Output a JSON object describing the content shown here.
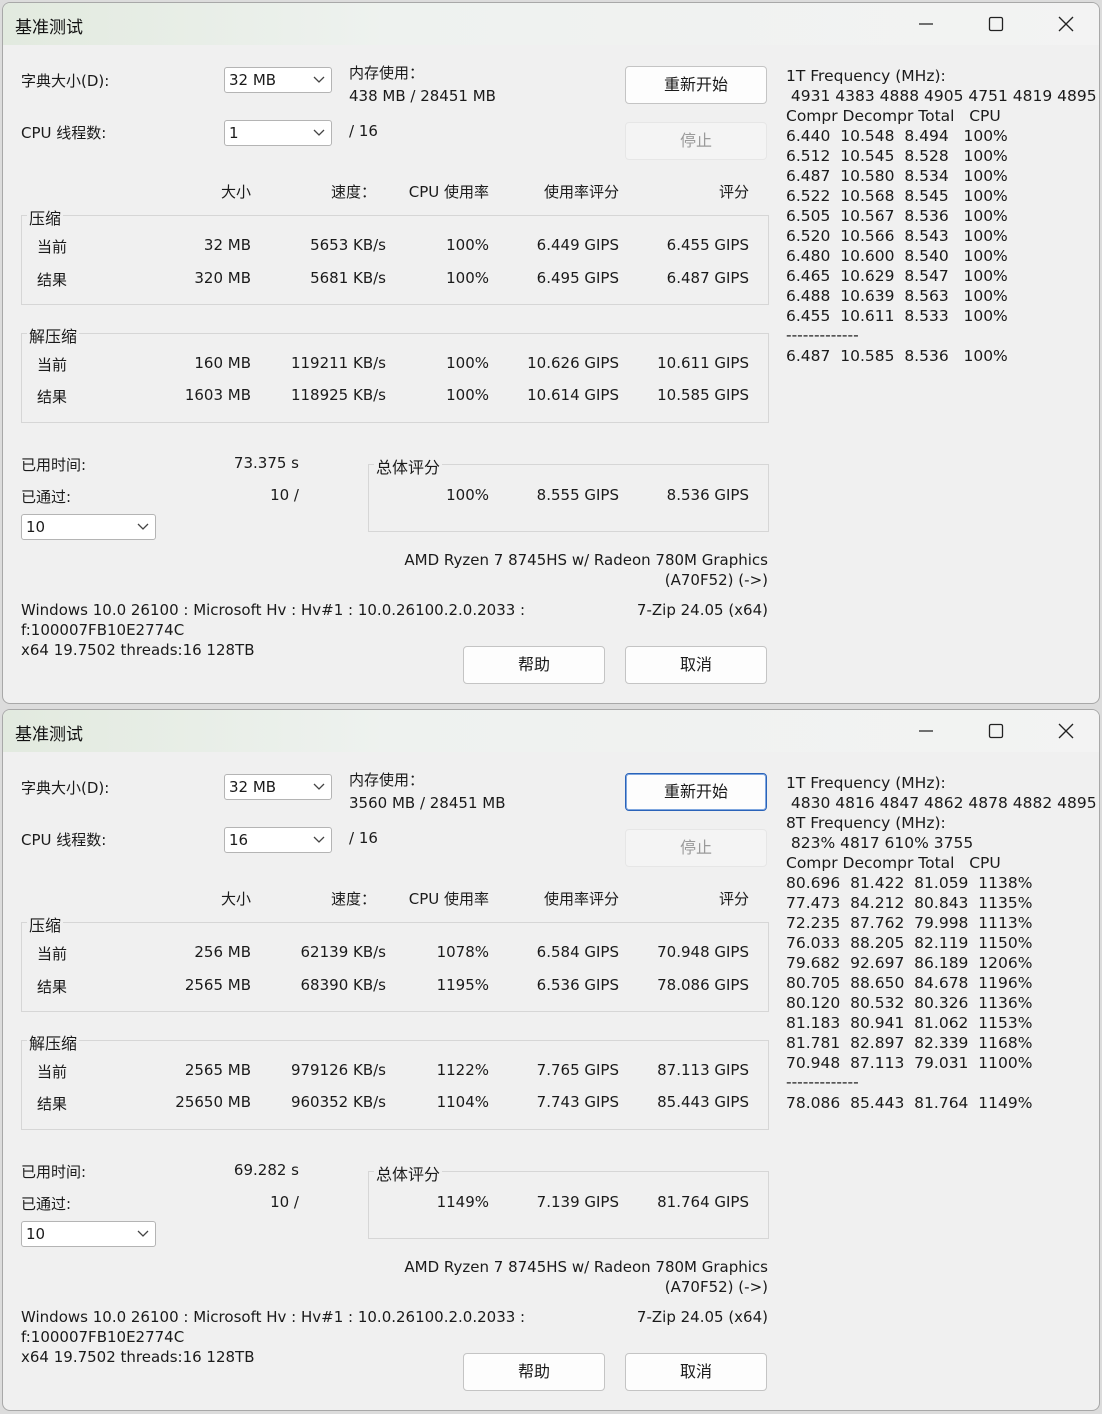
{
  "windows": [
    {
      "title": "基准测试",
      "dict_size_label": "字典大小(D):",
      "dict_size_value": "32 MB",
      "threads_label": "CPU 线程数:",
      "threads_value": "1",
      "threads_total": "/ 16",
      "memory_label": "内存使用：",
      "memory_value": "438 MB / 28451 MB",
      "restart_button": "重新开始",
      "stop_button": "停止",
      "headers": {
        "size": "大小",
        "speed": "速度：",
        "cpu": "CPU 使用率",
        "usage_rating": "使用率评分",
        "rating": "评分"
      },
      "compress": {
        "label": "压缩",
        "current": {
          "label": "当前",
          "size": "32 MB",
          "speed": "5653 KB/s",
          "cpu": "100%",
          "usage": "6.449 GIPS",
          "rating": "6.455 GIPS"
        },
        "result": {
          "label": "结果",
          "size": "320 MB",
          "speed": "5681 KB/s",
          "cpu": "100%",
          "usage": "6.495 GIPS",
          "rating": "6.487 GIPS"
        }
      },
      "decompress": {
        "label": "解压缩",
        "current": {
          "label": "当前",
          "size": "160 MB",
          "speed": "119211 KB/s",
          "cpu": "100%",
          "usage": "10.626 GIPS",
          "rating": "10.611 GIPS"
        },
        "result": {
          "label": "结果",
          "size": "1603 MB",
          "speed": "118925 KB/s",
          "cpu": "100%",
          "usage": "10.614 GIPS",
          "rating": "10.585 GIPS"
        }
      },
      "elapsed_label": "已用时间:",
      "elapsed_value": "73.375 s",
      "passed_label": "已通过:",
      "passed_value": "10 /",
      "passes_select": "10",
      "total_label": "总体评分",
      "total": {
        "cpu": "100%",
        "usage": "8.555 GIPS",
        "rating": "8.536 GIPS"
      },
      "cpu_name": "AMD Ryzen 7 8745HS w/ Radeon 780M Graphics",
      "cpu_id": "(A70F52) (->)",
      "sys_line1": "Windows 10.0 26100 : Microsoft Hv : Hv#1 : 10.0.26100.2.0.2033 :",
      "sys_line2": "f:100007FB10E2774C",
      "sys_line3": "x64 19.7502 threads:16 128TB",
      "version": "7-Zip 24.05 (x64)",
      "help_button": "帮助",
      "cancel_button": "取消",
      "right_lines": [
        "1T Frequency (MHz):",
        " 4931 4383 4888 4905 4751 4819 4895",
        "Compr Decompr Total   CPU",
        "6.440  10.548  8.494   100%",
        "6.512  10.545  8.528   100%",
        "6.487  10.580  8.534   100%",
        "6.522  10.568  8.545   100%",
        "6.505  10.567  8.536   100%",
        "6.520  10.566  8.543   100%",
        "6.480  10.600  8.540   100%",
        "6.465  10.629  8.547   100%",
        "6.488  10.639  8.563   100%",
        "6.455  10.611  8.533   100%",
        "-------------",
        "6.487  10.585  8.536   100%"
      ]
    },
    {
      "title": "基准测试",
      "dict_size_label": "字典大小(D):",
      "dict_size_value": "32 MB",
      "threads_label": "CPU 线程数:",
      "threads_value": "16",
      "threads_total": "/ 16",
      "memory_label": "内存使用：",
      "memory_value": "3560 MB / 28451 MB",
      "restart_button": "重新开始",
      "stop_button": "停止",
      "headers": {
        "size": "大小",
        "speed": "速度：",
        "cpu": "CPU 使用率",
        "usage_rating": "使用率评分",
        "rating": "评分"
      },
      "compress": {
        "label": "压缩",
        "current": {
          "label": "当前",
          "size": "256 MB",
          "speed": "62139 KB/s",
          "cpu": "1078%",
          "usage": "6.584 GIPS",
          "rating": "70.948 GIPS"
        },
        "result": {
          "label": "结果",
          "size": "2565 MB",
          "speed": "68390 KB/s",
          "cpu": "1195%",
          "usage": "6.536 GIPS",
          "rating": "78.086 GIPS"
        }
      },
      "decompress": {
        "label": "解压缩",
        "current": {
          "label": "当前",
          "size": "2565 MB",
          "speed": "979126 KB/s",
          "cpu": "1122%",
          "usage": "7.765 GIPS",
          "rating": "87.113 GIPS"
        },
        "result": {
          "label": "结果",
          "size": "25650 MB",
          "speed": "960352 KB/s",
          "cpu": "1104%",
          "usage": "7.743 GIPS",
          "rating": "85.443 GIPS"
        }
      },
      "elapsed_label": "已用时间:",
      "elapsed_value": "69.282 s",
      "passed_label": "已通过:",
      "passed_value": "10 /",
      "passes_select": "10",
      "total_label": "总体评分",
      "total": {
        "cpu": "1149%",
        "usage": "7.139 GIPS",
        "rating": "81.764 GIPS"
      },
      "cpu_name": "AMD Ryzen 7 8745HS w/ Radeon 780M Graphics",
      "cpu_id": "(A70F52) (->)",
      "sys_line1": "Windows 10.0 26100 : Microsoft Hv : Hv#1 : 10.0.26100.2.0.2033 :",
      "sys_line2": "f:100007FB10E2774C",
      "sys_line3": "x64 19.7502 threads:16 128TB",
      "version": "7-Zip 24.05 (x64)",
      "help_button": "帮助",
      "cancel_button": "取消",
      "right_lines": [
        "1T Frequency (MHz):",
        " 4830 4816 4847 4862 4878 4882 4895",
        "8T Frequency (MHz):",
        " 823% 4817 610% 3755",
        "Compr Decompr Total   CPU",
        "80.696  81.422  81.059  1138%",
        "77.473  84.212  80.843  1135%",
        "72.235  87.762  79.998  1113%",
        "76.033  88.205  82.119  1150%",
        "79.682  92.697  86.189  1206%",
        "80.705  88.650  84.678  1196%",
        "80.120  80.532  80.326  1136%",
        "81.183  80.941  81.062  1153%",
        "81.781  82.897  82.339  1168%",
        "70.948  87.113  79.031  1100%",
        "-------------",
        "78.086  85.443  81.764  1149%"
      ]
    }
  ]
}
